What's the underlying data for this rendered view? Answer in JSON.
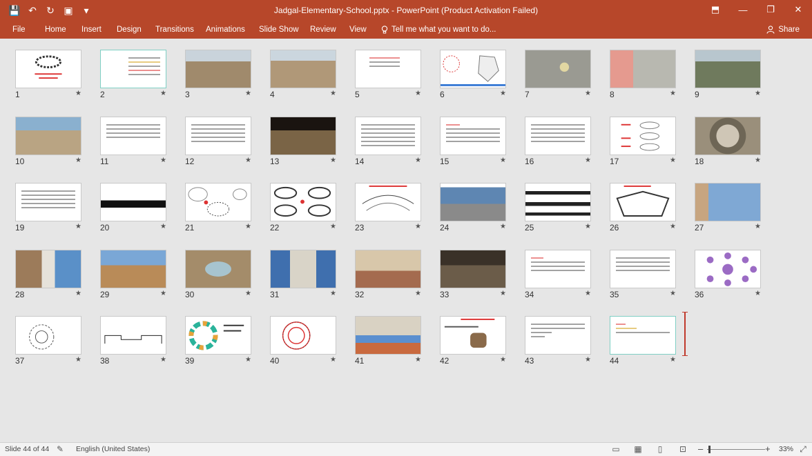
{
  "titlebar": {
    "title": "Jadgal-Elementary-School.pptx  -  PowerPoint (Product Activation Failed)",
    "save_icon": "💾",
    "undo_icon": "↶",
    "redo_icon": "↻",
    "present_icon": "▣",
    "more_icon": "▾",
    "restore_ribbon_icon": "⬒",
    "minimize_icon": "—",
    "maximize_icon": "❐",
    "close_icon": "✕"
  },
  "ribbon": {
    "file": "File",
    "home": "Home",
    "insert": "Insert",
    "design": "Design",
    "transitions": "Transitions",
    "animations": "Animations",
    "slideshow": "Slide Show",
    "review": "Review",
    "view": "View",
    "tellme": "Tell me what you want to do...",
    "share": "Share"
  },
  "slides": {
    "n1": "1",
    "n2": "2",
    "n3": "3",
    "n4": "4",
    "n5": "5",
    "n6": "6",
    "n7": "7",
    "n8": "8",
    "n9": "9",
    "n10": "10",
    "n11": "11",
    "n12": "12",
    "n13": "13",
    "n14": "14",
    "n15": "15",
    "n16": "16",
    "n17": "17",
    "n18": "18",
    "n19": "19",
    "n20": "20",
    "n21": "21",
    "n22": "22",
    "n23": "23",
    "n24": "24",
    "n25": "25",
    "n26": "26",
    "n27": "27",
    "n28": "28",
    "n29": "29",
    "n30": "30",
    "n31": "31",
    "n32": "32",
    "n33": "33",
    "n34": "34",
    "n35": "35",
    "n36": "36",
    "n37": "37",
    "n38": "38",
    "n39": "39",
    "n40": "40",
    "n41": "41",
    "n42": "42",
    "n43": "43",
    "n44": "44",
    "star": "★"
  },
  "status": {
    "slide_info": "Slide 44 of 44",
    "language": "English (United States)",
    "zoom": "33%",
    "zoom_minus": "–",
    "zoom_plus": "+"
  }
}
